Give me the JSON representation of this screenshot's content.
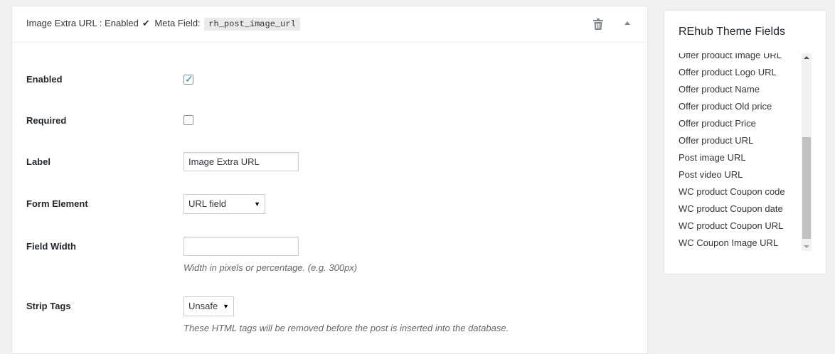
{
  "header": {
    "field_name": "Image Extra URL",
    "separator": ":",
    "enabled_text": "Enabled",
    "check_glyph": "✔",
    "meta_label": "Meta Field:",
    "meta_value": "rh_post_image_url",
    "delete_icon": "trash-icon",
    "collapse_icon": "arrow-up-icon"
  },
  "form": {
    "enabled": {
      "label": "Enabled",
      "checked": true
    },
    "required": {
      "label": "Required",
      "checked": false
    },
    "label": {
      "label": "Label",
      "value": "Image Extra URL"
    },
    "form_element": {
      "label": "Form Element",
      "value": "URL field"
    },
    "field_width": {
      "label": "Field Width",
      "value": "",
      "help": "Width in pixels or percentage. (e.g. 300px)"
    },
    "strip_tags": {
      "label": "Strip Tags",
      "value": "Unsafe",
      "help": "These HTML tags will be removed before the post is inserted into the database."
    }
  },
  "sidebar": {
    "title": "REhub Theme Fields",
    "items": [
      "Offer product Image URL",
      "Offer product Logo URL",
      "Offer product Name",
      "Offer product Old price",
      "Offer product Price",
      "Offer product URL",
      "Post image URL",
      "Post video URL",
      "WC product Coupon code",
      "WC product Coupon date",
      "WC product Coupon URL",
      "WC Coupon Image URL"
    ]
  },
  "colors": {
    "page_bg": "#f1f1f1",
    "panel_bg": "#ffffff",
    "checkbox_tick": "#1e8cbe",
    "code_bg": "#eaeaea"
  }
}
